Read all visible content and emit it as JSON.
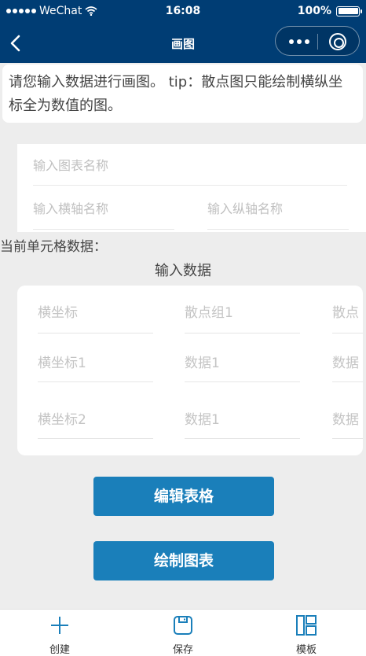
{
  "status_bar": {
    "carrier": "WeChat",
    "time": "16:08",
    "battery": "100%",
    "battery_level": 1.0
  },
  "nav": {
    "title": "画图",
    "back_icon": "chevron-left-icon",
    "more_icon": "more-dots-icon",
    "close_icon": "target-close-icon"
  },
  "tip": {
    "text": "请您输入数据进行画图。 tip：散点图只能绘制横纵坐标全为数值的图。"
  },
  "chart_fields": {
    "title_placeholder": "输入图表名称",
    "x_axis_placeholder": "输入横轴名称",
    "y_axis_placeholder": "输入纵轴名称"
  },
  "current_cell_label": "当前单元格数据：",
  "input_data_label": "输入数据",
  "table": {
    "rows": [
      [
        "横坐标",
        "散点组1",
        "散点"
      ],
      [
        "横坐标1",
        "数据1",
        "数据"
      ],
      [
        "横坐标2",
        "数据1",
        "数据"
      ]
    ]
  },
  "buttons": {
    "edit": "编辑表格",
    "draw": "绘制图表"
  },
  "tab_bar": {
    "items": [
      {
        "label": "创建",
        "icon": "plus-icon"
      },
      {
        "label": "保存",
        "icon": "save-icon"
      },
      {
        "label": "模板",
        "icon": "template-icon"
      }
    ]
  },
  "colors": {
    "nav_bg": "#003d74",
    "button_bg": "#1a7fba",
    "page_bg": "#ededed",
    "tab_icon": "#1a7fba"
  }
}
